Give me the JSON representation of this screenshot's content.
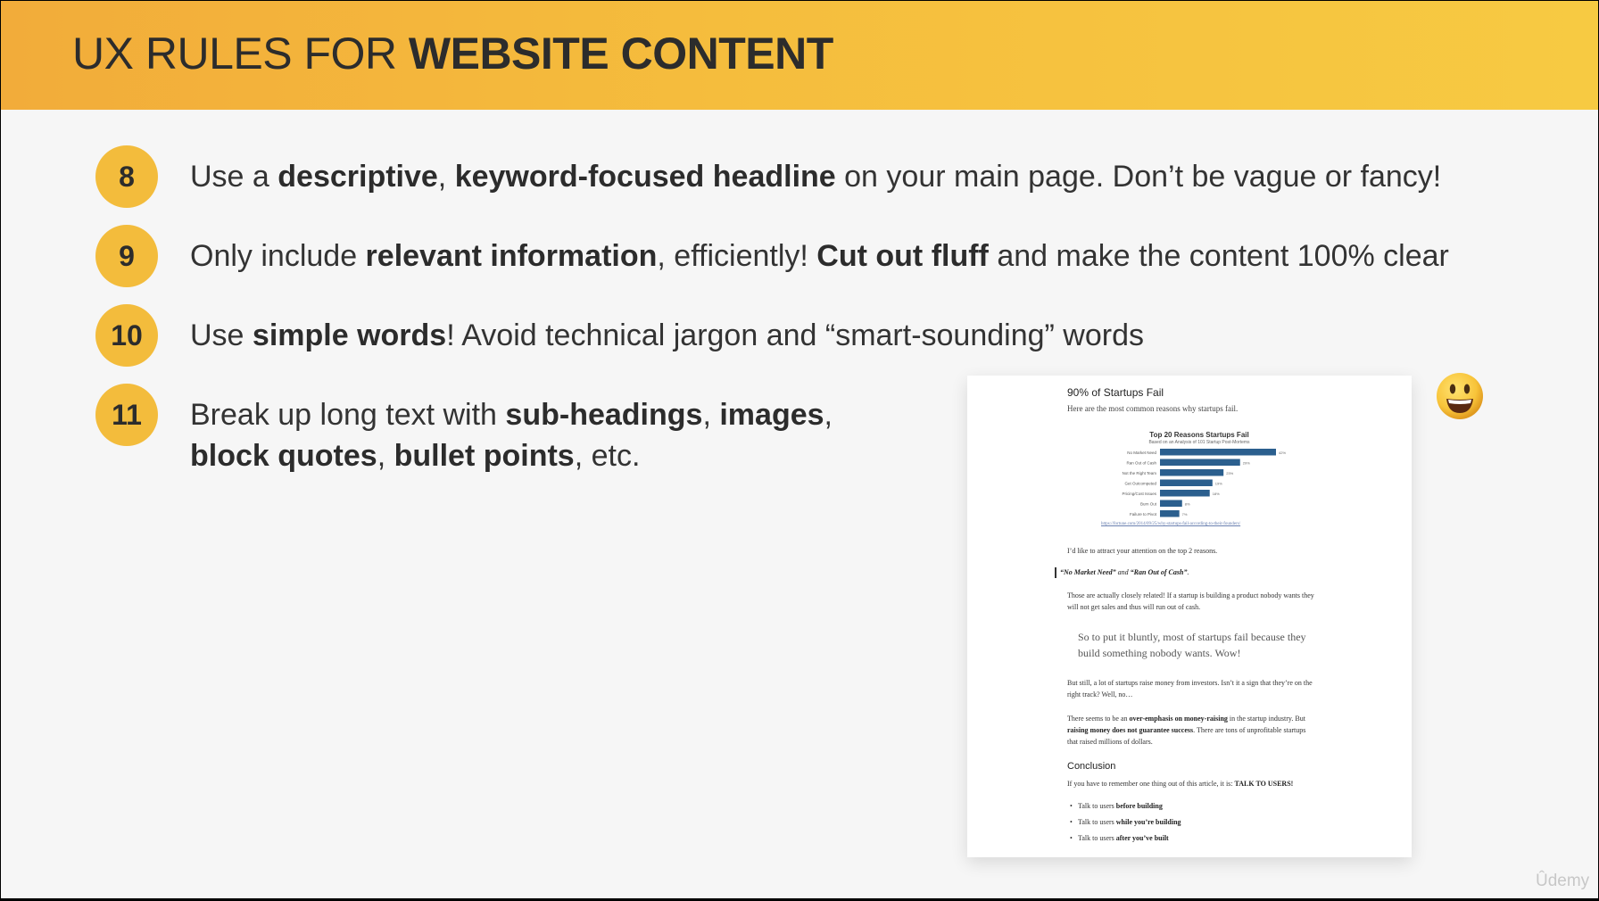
{
  "header": {
    "title_plain": "UX RULES FOR ",
    "title_bold": "WEBSITE CONTENT"
  },
  "rules": [
    {
      "number": "8",
      "parts": [
        {
          "t": "Use a ",
          "b": false
        },
        {
          "t": "descriptive",
          "b": true
        },
        {
          "t": ", ",
          "b": false
        },
        {
          "t": "keyword-focused headline",
          "b": true
        },
        {
          "t": " on your main page. Don’t be vague or fancy!",
          "b": false
        }
      ]
    },
    {
      "number": "9",
      "parts": [
        {
          "t": "Only include ",
          "b": false
        },
        {
          "t": "relevant information",
          "b": true
        },
        {
          "t": ", efficiently! ",
          "b": false
        },
        {
          "t": "Cut out fluff",
          "b": true
        },
        {
          "t": " and make the content 100% clear",
          "b": false
        }
      ]
    },
    {
      "number": "10",
      "parts": [
        {
          "t": "Use ",
          "b": false
        },
        {
          "t": "simple words",
          "b": true
        },
        {
          "t": "! Avoid technical jargon and “smart-sounding” words",
          "b": false
        }
      ]
    },
    {
      "number": "11",
      "parts": [
        {
          "t": "Break up long text with ",
          "b": false
        },
        {
          "t": "sub-headings",
          "b": true
        },
        {
          "t": ", ",
          "b": false
        },
        {
          "t": "images",
          "b": true
        },
        {
          "t": ",",
          "b": false
        },
        {
          "br": true
        },
        {
          "t": "block quotes",
          "b": true
        },
        {
          "t": ", ",
          "b": false
        },
        {
          "t": "bullet points",
          "b": true
        },
        {
          "t": ", etc.",
          "b": false
        }
      ]
    }
  ],
  "article": {
    "heading": "90% of Startups Fail",
    "subheading": "Here are the most common reasons why startups fail.",
    "chart_title": "Top 20 Reasons Startups Fail",
    "chart_subtitle": "Based on an Analysis of 101 Startup Post-Mortems",
    "chart_bars": [
      {
        "label": "No Market Need",
        "value": 42,
        "text": "42%"
      },
      {
        "label": "Ran Out of Cash",
        "value": 29,
        "text": "29%"
      },
      {
        "label": "Not the Right Team",
        "value": 23,
        "text": "23%"
      },
      {
        "label": "Get Outcompeted",
        "value": 19,
        "text": "19%"
      },
      {
        "label": "Pricing/Cost Issues",
        "value": 18,
        "text": "18%"
      },
      {
        "label": "Burn Out",
        "value": 8,
        "text": "8%"
      },
      {
        "label": "Failure to Pivot",
        "value": 7,
        "text": "7%"
      }
    ],
    "chart_link": "https://fortune.com/2014/09/25/why-startups-fail-according-to-their-founders/",
    "p1": "I’d like to attract your attention on the top 2 reasons.",
    "quote_a": "“No Market Need”",
    "quote_and": " and ",
    "quote_b": "“Ran Out of Cash”",
    "quote_end": ".",
    "p2": "Those are actually closely related! If a startup is building a product nobody wants they will not get sales and thus will run out of cash.",
    "big_quote": "So to put it bluntly, most of startups fail because they build something nobody wants. Wow!",
    "p3": "But still, a lot of startups raise money from investors. Isn’t it a sign that they’re on the right track? Well, no…",
    "p4_a": "There seems to be an ",
    "p4_b": "over-emphasis on money-raising",
    "p4_c": " in the startup industry. But ",
    "p4_d": "raising money does not guarantee success",
    "p4_e": ". There are tons of unprofitable startups that raised millions of dollars.",
    "conclusion_heading": "Conclusion",
    "conclusion_text": "If you have to remember one thing out of this article, it is: ",
    "conclusion_bold": "TALK TO USERS!",
    "bullets": [
      {
        "plain": "Talk to users ",
        "bold": "before building"
      },
      {
        "plain": "Talk to users ",
        "bold": "while you’re building"
      },
      {
        "plain": "Talk to users ",
        "bold": "after you’ve built"
      }
    ]
  },
  "watermark": "Ûdemy",
  "colors": {
    "header_start": "#f2ac3a",
    "header_end": "#f7ca42",
    "badge": "#f3bc3c",
    "chart_bar": "#2b5f8e"
  },
  "icons": {
    "emoji": "smiley-face-icon"
  }
}
